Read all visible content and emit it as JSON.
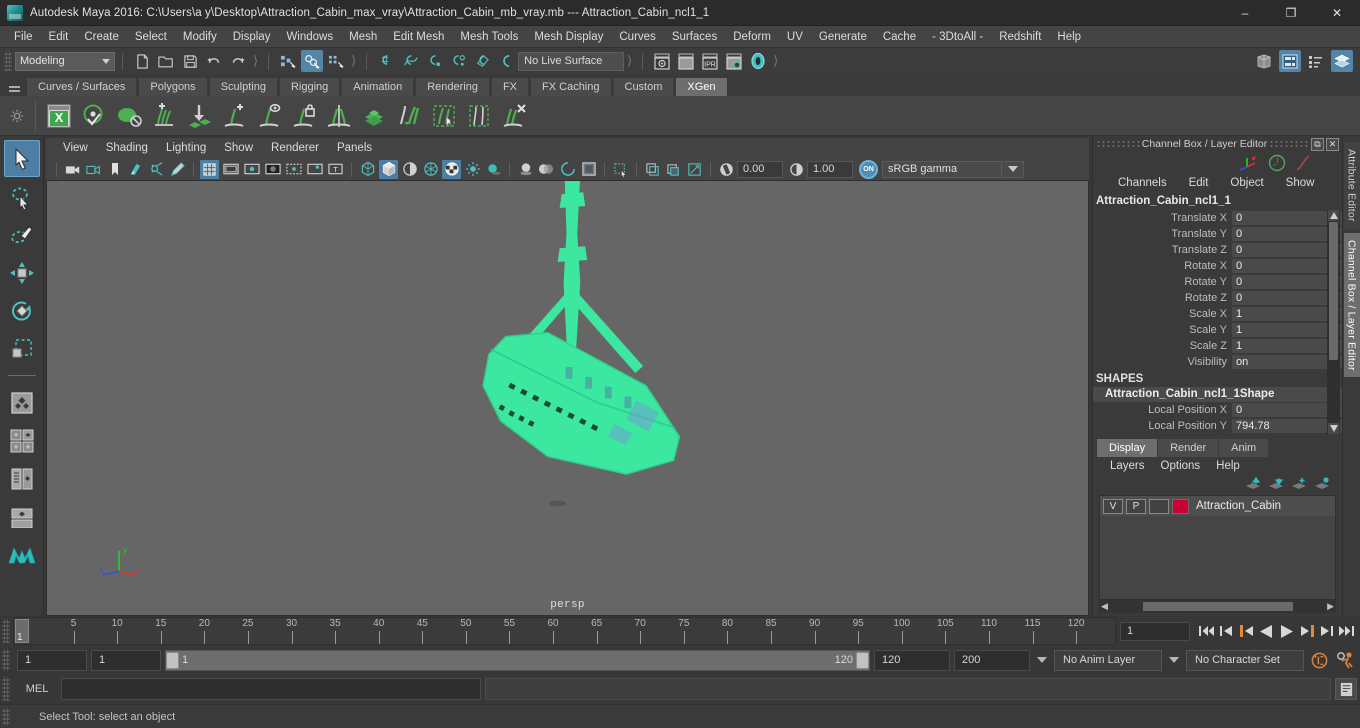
{
  "window": {
    "title": "Autodesk Maya 2016: C:\\Users\\a y\\Desktop\\Attraction_Cabin_max_vray\\Attraction_Cabin_mb_vray.mb  ---  Attraction_Cabin_ncl1_1",
    "minimize": "–",
    "restore": "❐",
    "close": "✕"
  },
  "main_menu": {
    "items": [
      "File",
      "Edit",
      "Create",
      "Select",
      "Modify",
      "Display",
      "Windows",
      "Mesh",
      "Edit Mesh",
      "Mesh Tools",
      "Mesh Display",
      "Curves",
      "Surfaces",
      "Deform",
      "UV",
      "Generate",
      "Cache",
      "- 3DtoAll -",
      "Redshift",
      "Help"
    ]
  },
  "status_line": {
    "menu_set": "Modeling",
    "live_surface": "No Live Surface",
    "icons": [
      "new-scene-icon",
      "open-scene-icon",
      "save-scene-icon",
      "undo-icon",
      "redo-icon",
      "select-by-hierarchy-icon",
      "select-by-object-icon",
      "select-by-component-icon",
      "snap-to-grid-icon",
      "snap-to-curve-icon",
      "snap-to-point-icon",
      "snap-to-projected-center-icon",
      "snap-to-view-plane-icon",
      "make-live-icon",
      "render-current-frame-icon",
      "render-sequence-icon",
      "ipr-render-icon",
      "render-settings-icon",
      "hypershade-icon"
    ],
    "right_icons": [
      "show-hide-modeling-toolkit-icon",
      "attribute-editor-icon",
      "tool-settings-icon",
      "channel-box-layer-editor-icon"
    ]
  },
  "shelf": {
    "tabs": [
      "Curves / Surfaces",
      "Polygons",
      "Sculpting",
      "Rigging",
      "Animation",
      "Rendering",
      "FX",
      "FX Caching",
      "Custom",
      "XGen"
    ],
    "active_tab": "XGen",
    "icons": [
      "xgen-editor-icon",
      "xgen-preview-icon",
      "xgen-description-icon",
      "xgen-add-groom-icon",
      "xgen-place-primitives-icon",
      "xgen-add-guides-icon",
      "xgen-preview-guides-icon",
      "xgen-lock-guides-icon",
      "xgen-split-guides-icon",
      "xgen-density-icon",
      "xgen-clump-icon",
      "xgen-region-select-icon",
      "xgen-region-mask-icon",
      "xgen-delete-guides-icon"
    ]
  },
  "toolbox": {
    "items": [
      {
        "name": "select-tool",
        "active": true
      },
      {
        "name": "lasso-select-tool",
        "active": false
      },
      {
        "name": "paint-select-tool",
        "active": false
      },
      {
        "name": "move-tool",
        "active": false
      },
      {
        "name": "rotate-tool",
        "active": false
      },
      {
        "name": "scale-tool",
        "active": false
      },
      {
        "name": "last-tool-used",
        "active": false
      },
      {
        "name": "four-view-layout",
        "active": false
      },
      {
        "name": "single-perspective-layout",
        "active": false
      },
      {
        "name": "outliner-persp-layout",
        "active": false
      },
      {
        "name": "hypergraph-persp-layout",
        "active": false
      },
      {
        "name": "persp-graph-editor-layout",
        "active": false
      },
      {
        "name": "maya-logo-icon",
        "active": false
      }
    ]
  },
  "viewport": {
    "menu": [
      "View",
      "Shading",
      "Lighting",
      "Show",
      "Renderer",
      "Panels"
    ],
    "toolbar_icons": [
      "select-camera-icon",
      "camera-attributes-icon",
      "bookmark-icon",
      "image-plane-icon",
      "two-d-pan-zoom-icon",
      "grease-pencil-icon",
      "grid-toggle-icon",
      "film-gate-icon",
      "resolution-gate-icon",
      "gate-mask-icon",
      "film-origin-icon",
      "film-pivot-icon",
      "safe-title-icon",
      "wireframe-icon",
      "smooth-shade-all-icon",
      "smooth-shade-selected-icon",
      "flat-shade-icon",
      "shaded-textured-icon",
      "use-default-light-icon",
      "shadows-icon",
      "screen-space-ao-icon",
      "motion-blur-icon",
      "multisample-aa-icon",
      "isolate-select-icon",
      "xray-icon"
    ],
    "exposure_value": "0.00",
    "gamma_value": "1.00",
    "color_space": "sRGB gamma",
    "toggle_badge": "ON",
    "label": "persp",
    "axis": {
      "x": "x",
      "y": "y",
      "z": "z"
    },
    "model_color": "#3ce8a0",
    "background_color": "#666666"
  },
  "channel_box": {
    "panel_title": "Channel Box / Layer Editor",
    "menu": [
      "Channels",
      "Edit",
      "Object",
      "Show"
    ],
    "object_name": "Attraction_Cabin_ncl1_1",
    "channels": [
      {
        "label": "Translate X",
        "value": "0"
      },
      {
        "label": "Translate Y",
        "value": "0"
      },
      {
        "label": "Translate Z",
        "value": "0"
      },
      {
        "label": "Rotate X",
        "value": "0"
      },
      {
        "label": "Rotate Y",
        "value": "0"
      },
      {
        "label": "Rotate Z",
        "value": "0"
      },
      {
        "label": "Scale X",
        "value": "1"
      },
      {
        "label": "Scale Y",
        "value": "1"
      },
      {
        "label": "Scale Z",
        "value": "1"
      },
      {
        "label": "Visibility",
        "value": "on"
      }
    ],
    "shapes_header": "SHAPES",
    "shape_name": "Attraction_Cabin_ncl1_1Shape",
    "shape_channels": [
      {
        "label": "Local Position X",
        "value": "0"
      },
      {
        "label": "Local Position Y",
        "value": "794.78"
      }
    ]
  },
  "layer_editor": {
    "tabs": [
      "Display",
      "Render",
      "Anim"
    ],
    "active_tab": "Display",
    "menu": [
      "Layers",
      "Options",
      "Help"
    ],
    "icons": [
      "move-layer-up-icon",
      "move-layer-down-icon",
      "new-layer-icon",
      "new-layer-from-selected-icon"
    ],
    "layers": [
      {
        "visibility": "V",
        "playback": "P",
        "type": "",
        "color": "#cc0033",
        "name": "Attraction_Cabin"
      }
    ]
  },
  "vertical_tabs": {
    "items": [
      "Attribute Editor",
      "Channel Box / Layer Editor"
    ],
    "active": "Channel Box / Layer Editor"
  },
  "time_slider": {
    "current_frame": "1",
    "ticks": [
      5,
      10,
      15,
      20,
      25,
      30,
      35,
      40,
      45,
      50,
      55,
      60,
      65,
      70,
      75,
      80,
      85,
      90,
      95,
      100,
      105,
      110,
      115,
      120
    ],
    "frame_field": "1",
    "playback_buttons": [
      "go-to-start-icon",
      "step-back-frame-icon",
      "step-back-key-icon",
      "play-backwards-icon",
      "play-forwards-icon",
      "step-forward-key-icon",
      "step-forward-frame-icon",
      "go-to-end-icon"
    ]
  },
  "range_slider": {
    "anim_start": "1",
    "playback_start": "1",
    "range_left_label": "1",
    "range_right_label": "120",
    "playback_end": "120",
    "anim_end": "200",
    "anim_layer": "No Anim Layer",
    "character_set": "No Character Set",
    "icons": [
      "auto-keyframe-icon",
      "animation-preferences-icon"
    ]
  },
  "command_line": {
    "label": "MEL",
    "input_value": "",
    "output_value": "",
    "script_editor_icon": "script-editor-icon"
  },
  "help_line": {
    "text": "Select Tool: select an object"
  }
}
